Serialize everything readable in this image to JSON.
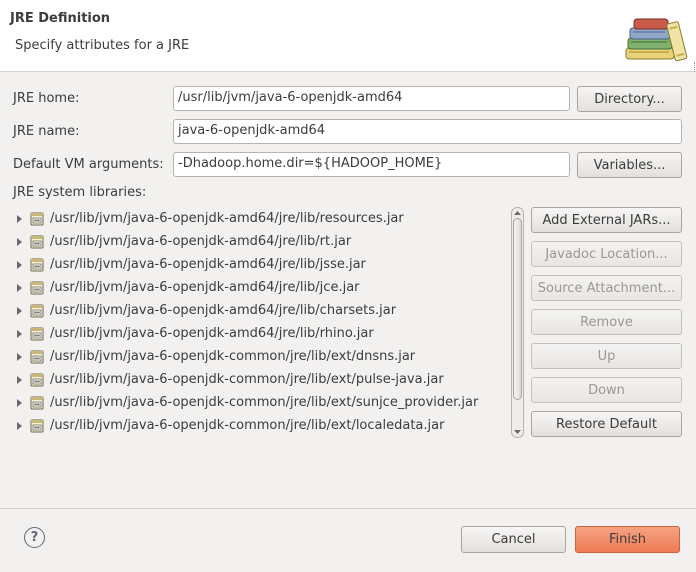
{
  "header": {
    "title": "JRE Definition",
    "subtitle": "Specify attributes for a JRE"
  },
  "form": {
    "jre_home_label": "JRE home:",
    "jre_home_value": "/usr/lib/jvm/java-6-openjdk-amd64",
    "directory_button": "Directory...",
    "jre_name_label": "JRE name:",
    "jre_name_value": "java-6-openjdk-amd64",
    "vm_args_label": "Default VM arguments:",
    "vm_args_value": "-Dhadoop.home.dir=${HADOOP_HOME}",
    "variables_button": "Variables...",
    "libraries_label": "JRE system libraries:"
  },
  "libraries": [
    "/usr/lib/jvm/java-6-openjdk-amd64/jre/lib/resources.jar",
    "/usr/lib/jvm/java-6-openjdk-amd64/jre/lib/rt.jar",
    "/usr/lib/jvm/java-6-openjdk-amd64/jre/lib/jsse.jar",
    "/usr/lib/jvm/java-6-openjdk-amd64/jre/lib/jce.jar",
    "/usr/lib/jvm/java-6-openjdk-amd64/jre/lib/charsets.jar",
    "/usr/lib/jvm/java-6-openjdk-amd64/jre/lib/rhino.jar",
    "/usr/lib/jvm/java-6-openjdk-common/jre/lib/ext/dnsns.jar",
    "/usr/lib/jvm/java-6-openjdk-common/jre/lib/ext/pulse-java.jar",
    "/usr/lib/jvm/java-6-openjdk-common/jre/lib/ext/sunjce_provider.jar",
    "/usr/lib/jvm/java-6-openjdk-common/jre/lib/ext/localedata.jar"
  ],
  "side_buttons": {
    "add_external_jars": "Add External JARs...",
    "javadoc_location": "Javadoc Location...",
    "source_attachment": "Source Attachment...",
    "remove": "Remove",
    "up": "Up",
    "down": "Down",
    "restore_default": "Restore Default"
  },
  "footer": {
    "help_glyph": "?",
    "cancel": "Cancel",
    "finish": "Finish"
  },
  "icons": {
    "header": "library-books-icon",
    "library_row": "jar-file-icon",
    "help": "help-icon"
  },
  "colors": {
    "finish_accent": "#ef7b55",
    "background": "#f2f1f0"
  }
}
